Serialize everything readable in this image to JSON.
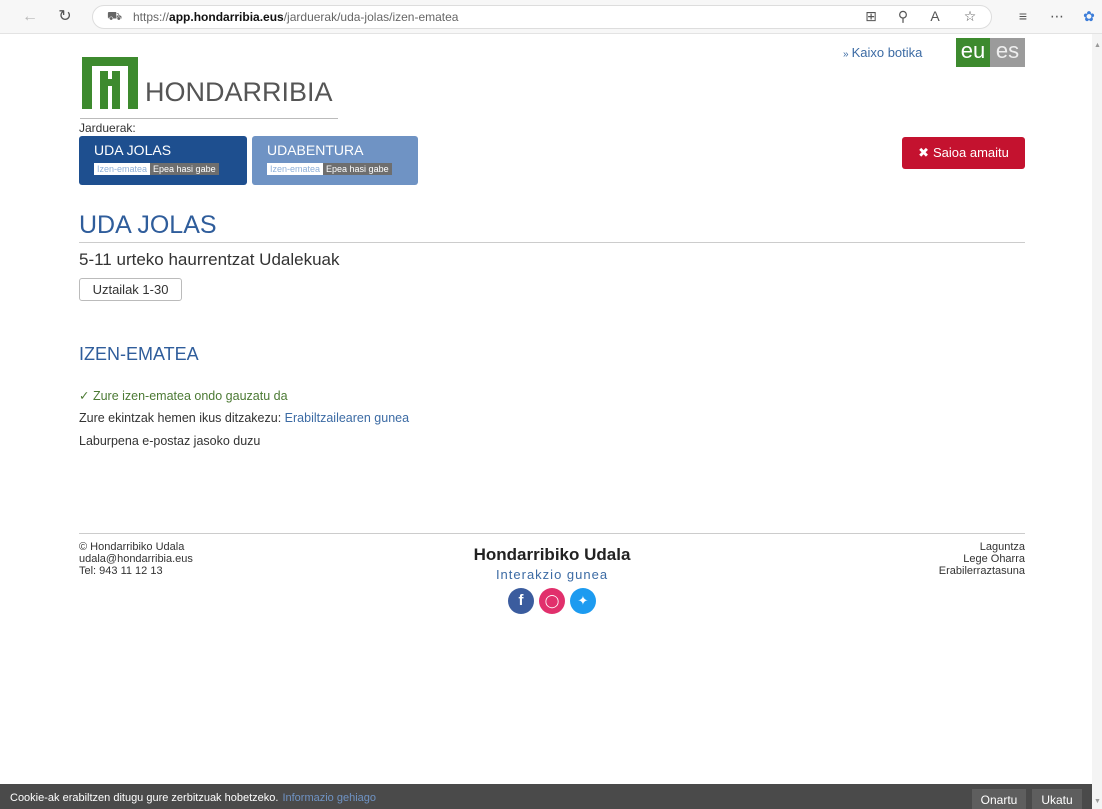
{
  "browser": {
    "url_prefix": "https://",
    "url_host": "app.hondarribia.eus",
    "url_path": "/jarduerak/uda-jolas/izen-ematea"
  },
  "header": {
    "logo_text": "HONDARRIBIA",
    "greeting": "Kaixo botika",
    "lang_eu": "eu",
    "lang_es": "es",
    "logout_label": "Saioa amaitu",
    "activities_label": "Jarduerak:",
    "tabs": [
      {
        "name": "UDA JOLAS",
        "badge1": "Izen-ematea",
        "badge2": "Epea hasi gabe"
      },
      {
        "name": "UDABENTURA",
        "badge1": "Izen-ematea",
        "badge2": "Epea hasi gabe"
      }
    ]
  },
  "main": {
    "title": "UDA JOLAS",
    "subtitle": "5-11 urteko haurrentzat Udalekuak",
    "date_range": "Uztailak 1-30",
    "section_title": "IZEN-EMATEA",
    "success_message": "Zure izen-ematea ondo gauzatu da",
    "info_prefix": "Zure ekintzak hemen ikus ditzakezu:",
    "info_link": "Erabiltzailearen gunea",
    "summary_note": "Laburpena e-postaz jasoko duzu"
  },
  "footer": {
    "copyright": "© Hondarribiko Udala",
    "email": "udala@hondarribia.eus",
    "phone": "Tel: 943 11 12 13",
    "org_name": "Hondarribiko Udala",
    "portal_name": "Interakzio gunea",
    "links": [
      "Laguntza",
      "Lege Oharra",
      "Erabilerraztasuna"
    ]
  },
  "cookie": {
    "text": "Cookie-ak erabiltzen ditugu gure zerbitzuak hobetzeko.",
    "link": "Informazio gehiago",
    "accept": "Onartu",
    "reject": "Ukatu"
  },
  "colors": {
    "brand_green": "#3d8a2e",
    "primary_blue": "#1e4f8f",
    "danger_red": "#c4122f"
  }
}
